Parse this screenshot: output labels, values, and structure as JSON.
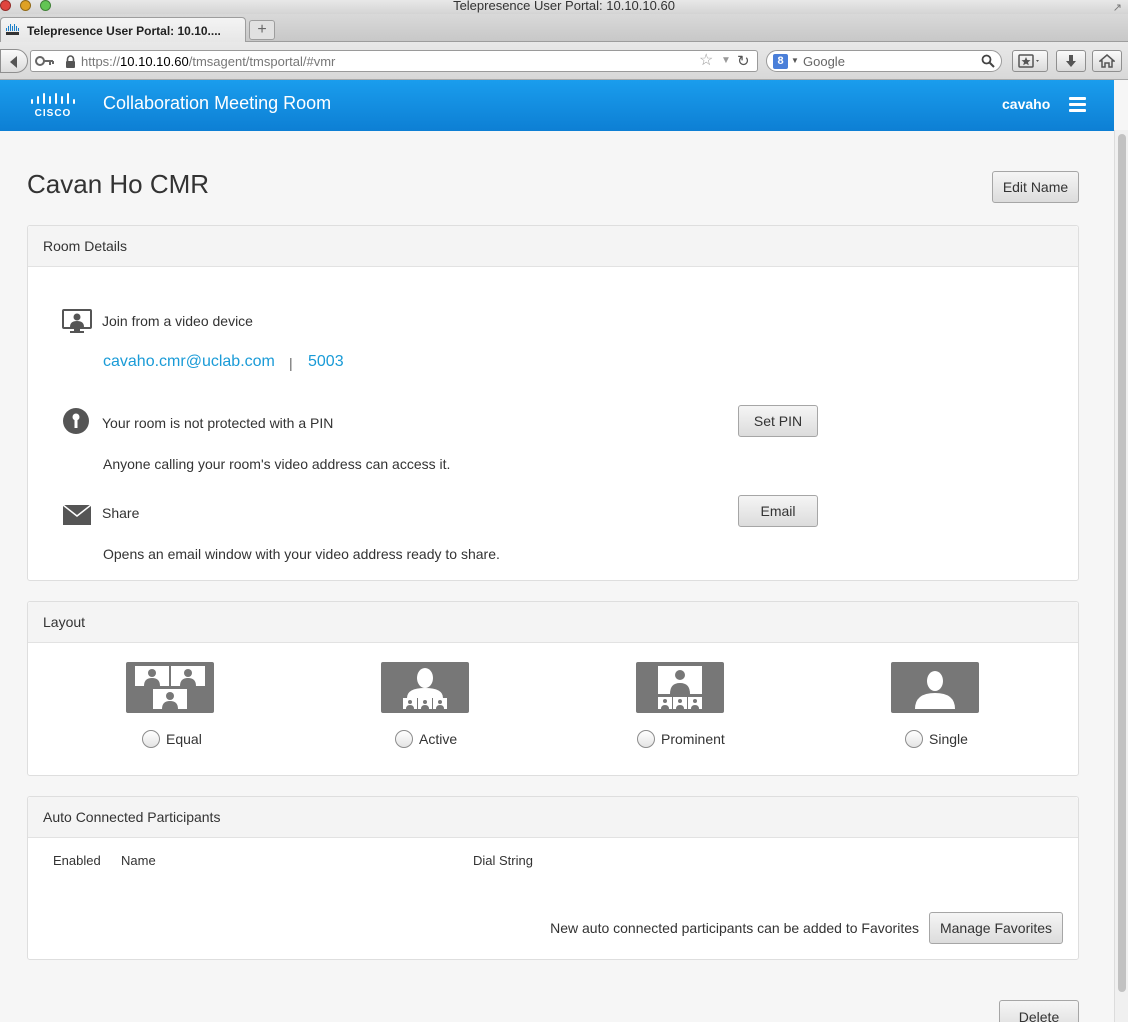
{
  "browser": {
    "window_title": "Telepresence User Portal: 10.10.10.60",
    "tab_title": "Telepresence User Portal: 10.10....",
    "new_tab_label": "+",
    "url_prefix": "https://",
    "url_host": "10.10.10.60",
    "url_path": "/tmsagent/tmsportal/#vmr",
    "search_engine_badge": "8",
    "search_placeholder": "Google"
  },
  "header": {
    "brand": "CISCO",
    "app_title": "Collaboration Meeting Room",
    "user": "cavaho"
  },
  "page": {
    "title": "Cavan Ho CMR",
    "edit_name_label": "Edit Name",
    "delete_label": "Delete"
  },
  "room_details": {
    "heading": "Room Details",
    "join_label": "Join from a video device",
    "video_address": "cavaho.cmr@uclab.com",
    "separator": "|",
    "numeric_id": "5003",
    "pin_label": "Your room is not protected with a PIN",
    "pin_sub": "Anyone calling your room's video address can access it.",
    "set_pin_label": "Set PIN",
    "share_label": "Share",
    "share_sub": "Opens an email window with your video address ready to share.",
    "email_label": "Email"
  },
  "layout": {
    "heading": "Layout",
    "options": [
      {
        "label": "Equal",
        "icon": "layout-equal-icon",
        "selected": false
      },
      {
        "label": "Active",
        "icon": "layout-active-icon",
        "selected": false
      },
      {
        "label": "Prominent",
        "icon": "layout-prominent-icon",
        "selected": false
      },
      {
        "label": "Single",
        "icon": "layout-single-icon",
        "selected": false
      }
    ]
  },
  "auto_connected": {
    "heading": "Auto Connected Participants",
    "columns": [
      "Enabled",
      "Name",
      "Dial String"
    ],
    "rows": [],
    "favorites_note": "New auto connected participants can be added to Favorites",
    "manage_favorites_label": "Manage Favorites"
  },
  "colors": {
    "header_blue": "#0d7fd4",
    "link_blue": "#1a9bd7",
    "thumb_gray": "#777777"
  }
}
